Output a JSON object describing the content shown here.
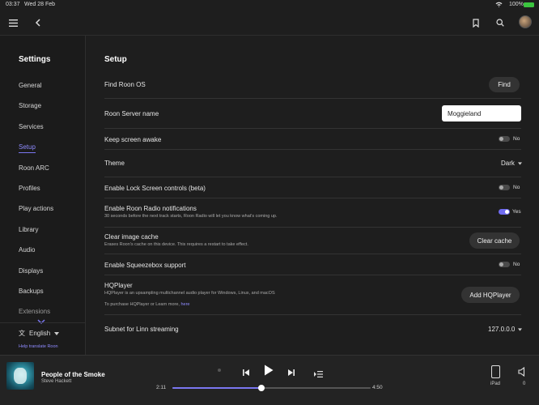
{
  "status": {
    "time": "03:37",
    "date": "Wed 28 Feb",
    "battery": "100%"
  },
  "topbar": {
    "menu_icon": "hamburger-icon",
    "back_icon": "chevron-left-icon"
  },
  "sidebar": {
    "title": "Settings",
    "items": [
      {
        "label": "General"
      },
      {
        "label": "Storage"
      },
      {
        "label": "Services"
      },
      {
        "label": "Setup",
        "active": true
      },
      {
        "label": "Roon ARC"
      },
      {
        "label": "Profiles"
      },
      {
        "label": "Play actions"
      },
      {
        "label": "Library"
      },
      {
        "label": "Audio"
      },
      {
        "label": "Displays"
      },
      {
        "label": "Backups"
      },
      {
        "label": "Extensions"
      }
    ],
    "language": "English",
    "translate_link": "Help translate Roon"
  },
  "setup": {
    "title": "Setup",
    "find_roon_os": {
      "label": "Find Roon OS",
      "button": "Find"
    },
    "server_name": {
      "label": "Roon Server name",
      "value": "Moggieland"
    },
    "keep_awake": {
      "label": "Keep screen awake",
      "state": "No"
    },
    "theme": {
      "label": "Theme",
      "value": "Dark"
    },
    "lock_screen": {
      "label": "Enable Lock Screen controls (beta)",
      "state": "No"
    },
    "radio_notifications": {
      "label": "Enable Roon Radio notifications",
      "sub": "30 seconds before the next track starts, Roon Radio will let you know what's coming up.",
      "state": "Yes"
    },
    "clear_cache": {
      "label": "Clear image cache",
      "sub": "Erases Roon's cache on this device. This requires a restart to take effect.",
      "button": "Clear cache"
    },
    "squeezebox": {
      "label": "Enable Squeezebox support",
      "state": "No"
    },
    "hqplayer": {
      "label": "HQPlayer",
      "sub": "HQPlayer is an upsampling multichannel audio player for Windows, Linux, and macOS",
      "purchase_prefix": "To purchase HQPlayer or Learn more,",
      "purchase_link": "here",
      "button": "Add HQPlayer"
    },
    "linn": {
      "label": "Subnet for Linn streaming",
      "value": "127.0.0.0"
    }
  },
  "player": {
    "track": "People of the Smoke",
    "artist": "Steve Hackett",
    "elapsed": "2:11",
    "duration": "4:50",
    "progress": 0.45,
    "zone": "iPad",
    "volume": "0"
  }
}
